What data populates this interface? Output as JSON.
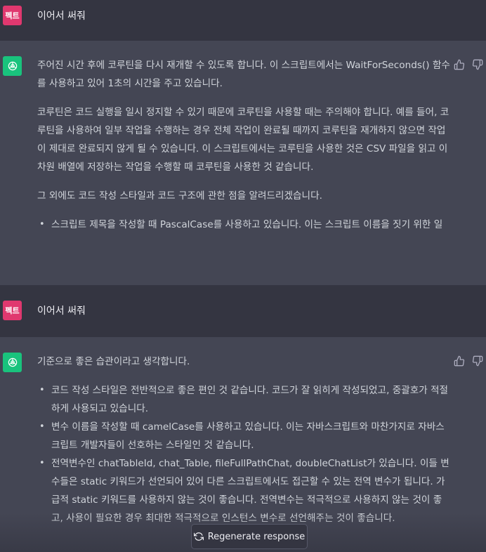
{
  "messages": [
    {
      "user": {
        "avatar_label": "펙트",
        "text": "이어서 써줘"
      },
      "assistant": {
        "paragraphs": [
          "주어진 시간 후에 코루틴을 다시 재개할 수 있도록 합니다. 이 스크립트에서는 WaitForSeconds() 함수를 사용하고 있어 1초의 시간을 주고 있습니다.",
          "코루틴은 코드 실행을 일시 정지할 수 있기 때문에 코루틴을 사용할 때는 주의해야 합니다. 예를 들어, 코루틴을 사용하여 일부 작업을 수행하는 경우 전체 작업이 완료될 때까지 코루틴을 재개하지 않으면 작업이 제대로 완료되지 않게 될 수 있습니다. 이 스크립트에서는 코루틴을 사용한 것은 CSV 파일을 읽고 이차원 배열에 저장하는 작업을 수행할 때 코루틴을 사용한 것 같습니다.",
          "그 외에도 코드 작성 스타일과 코드 구조에 관한 점을 알려드리겠습니다."
        ],
        "bullets": [
          "스크립트 제목을 작성할 때 PascalCase를 사용하고 있습니다. 이는 스크립트 이름을 짓기 위한 일"
        ]
      }
    },
    {
      "user": {
        "avatar_label": "펙트",
        "text": "이어서 써줘"
      },
      "assistant": {
        "paragraphs": [
          "기준으로 좋은 습관이라고 생각합니다."
        ],
        "bullets": [
          "코드 작성 스타일은 전반적으로 좋은 편인 것 같습니다. 코드가 잘 읽히게 작성되었고, 중괄호가 적절하게 사용되고 있습니다.",
          "변수 이름을 작성할 때 camelCase를 사용하고 있습니다. 이는 자바스크립트와 마찬가지로 자바스크립트 개발자들이 선호하는 스타일인 것 같습니다.",
          "전역변수인 chatTableId, chat_Table, fileFullPathChat, doubleChatList가 있습니다. 이들 변수들은 static 키워드가 선언되어 있어 다른 스크립트에서도 접근할 수 있는 전역 변수가 됩니다. 가급적 static 키워드를 사용하지 않는 것이 좋습니다. 전역변수는 적극적으로 사용하지 않는 것이 좋고, 사용이 필요한 경우 최대한 적극적으로 인스턴스 변수로 선언해주는 것이 좋습니다."
        ]
      }
    }
  ],
  "regenerate_label": "Regenerate response",
  "icons": {
    "bot_avatar": "openai-logo-icon",
    "thumbs_up": "thumbs-up-icon",
    "thumbs_down": "thumbs-down-icon",
    "regenerate": "refresh-icon"
  },
  "colors": {
    "user_bg": "#343541",
    "assistant_bg": "#444654",
    "user_avatar": "#e0386f",
    "bot_avatar": "#19c37d"
  }
}
